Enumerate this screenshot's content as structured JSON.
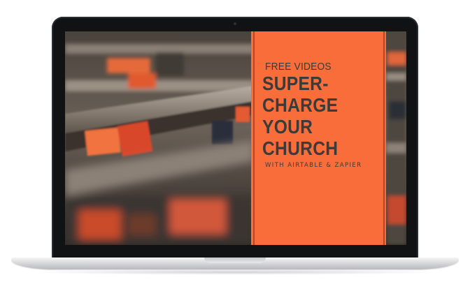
{
  "promo": {
    "kicker": "FREE VIDEOS",
    "headline_lines": [
      "SUPER-",
      "CHARGE",
      "YOUR",
      "CHURCH"
    ],
    "subline": "WITH AIRTABLE & ZAPIER"
  },
  "colors": {
    "panel": "#f96d3b",
    "panel_text": "#3b3b3b",
    "laptop_bezel": "#111214",
    "laptop_base": "#d9d9db"
  },
  "images": {
    "screen_photo": "church-pews-with-hymnals-photo",
    "device": "laptop-mockup"
  }
}
